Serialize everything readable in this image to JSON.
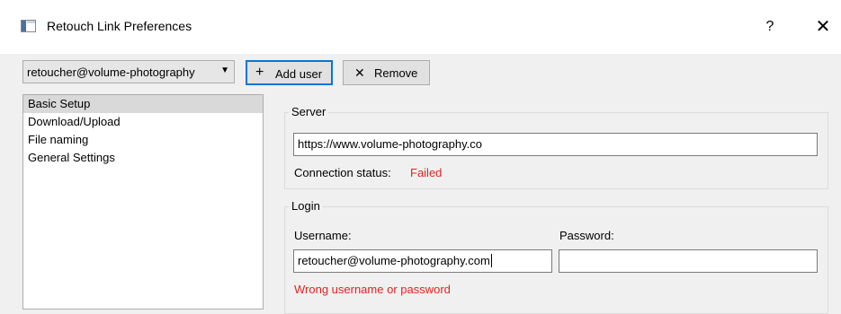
{
  "window": {
    "title": "Retouch Link Preferences",
    "help_glyph": "?",
    "close_glyph": "✕"
  },
  "toolbar": {
    "user_select_value": "retoucher@volume-photography",
    "add_user_label": "Add user",
    "add_icon": "plus-icon",
    "remove_label": "Remove",
    "remove_icon": "x-icon"
  },
  "nav": {
    "items": [
      {
        "label": "Basic Setup",
        "selected": true
      },
      {
        "label": "Download/Upload",
        "selected": false
      },
      {
        "label": "File naming",
        "selected": false
      },
      {
        "label": "General Settings",
        "selected": false
      }
    ]
  },
  "server": {
    "group_title": "Server",
    "url_value": "https://www.volume-photography.co",
    "status_label": "Connection status:",
    "status_value": "Failed"
  },
  "login": {
    "group_title": "Login",
    "username_label": "Username:",
    "password_label": "Password:",
    "username_value": "retoucher@volume-photography.com",
    "password_value": "",
    "error_message": "Wrong username or password"
  },
  "colors": {
    "error": "#e02424",
    "focus_border": "#0078d7"
  }
}
